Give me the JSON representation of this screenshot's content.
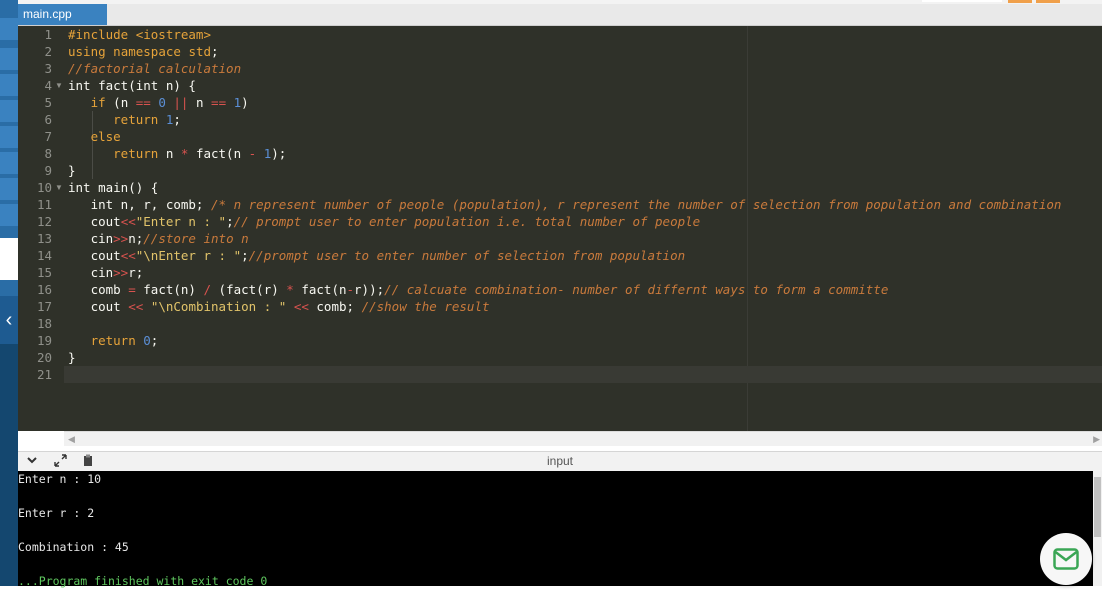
{
  "tab": {
    "title": "main.cpp"
  },
  "io_panel": {
    "title": "input"
  },
  "code": {
    "line_numbers": [
      "1",
      "2",
      "3",
      "4",
      "5",
      "6",
      "7",
      "8",
      "9",
      "10",
      "11",
      "12",
      "13",
      "14",
      "15",
      "16",
      "17",
      "18",
      "19",
      "20",
      "21"
    ]
  },
  "terminal": {
    "lines": [
      "Enter n : 10",
      "",
      "Enter r : 2",
      "",
      "Combination : 45",
      "",
      "...Program finished with exit code 0"
    ]
  },
  "icons": {
    "collapse": "chevron-down-icon",
    "expand": "expand-icon",
    "copy": "clipboard-icon",
    "sidebar_toggle": "chevron-left-icon",
    "mail": "mail-icon"
  },
  "colors": {
    "tab_active": "#3a82c0",
    "editor_bg": "#2f3129",
    "terminal_bg": "#000000",
    "exit_message": "#5fc75f"
  }
}
